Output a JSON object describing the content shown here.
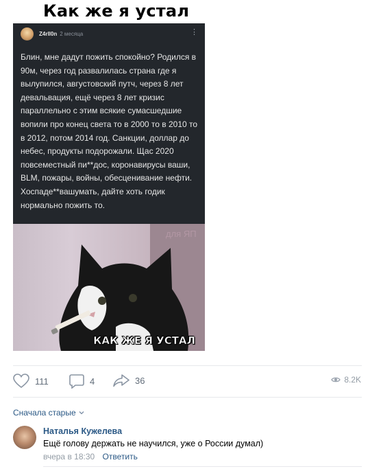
{
  "meme": {
    "title": "Как же я устал",
    "caption": "КАК ЖЕ Я УСТАЛ",
    "watermark": "для ЯП"
  },
  "card": {
    "author": "Z4rll0n",
    "time": "2 месяца",
    "text": "Блин, мне дадут пожить спокойно? Родился в 90м, через год развалилась страна где я вылупился, августовский путч, через 8 лет девальвация, ещё через 8 лет кризис параллельно с этим всякие сумасшедшие вопили про конец света то в 2000 то в 2010 то в 2012, потом 2014 год. Санкции, доллар до небес, продукты подорожали. Щас 2020 повсеместный пи**дос, коронавирусы ваши, BLM, пожары, войны, обесценивание нефти. Хоспаде**вашумать, дайте хоть годик нормально пожить то."
  },
  "actions": {
    "likes": "111",
    "comments": "4",
    "shares": "36",
    "views": "8.2K"
  },
  "comments": {
    "sort_label": "Сначала старые",
    "items": [
      {
        "author": "Наталья Кужелева",
        "text": "Ещё голову держать не научился, уже о России думал)",
        "time": "вчера в 18:30",
        "reply_label": "Ответить"
      }
    ]
  },
  "colors": {
    "link": "#2a5885",
    "muted": "#939ca5",
    "card_bg": "#23272c"
  }
}
